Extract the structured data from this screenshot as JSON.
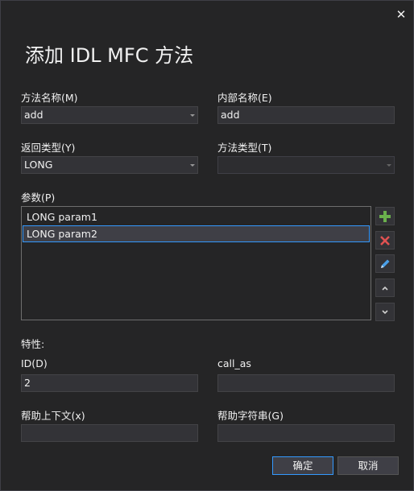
{
  "dialog": {
    "title": "添加 IDL MFC 方法",
    "close_icon": "close-icon"
  },
  "method_name": {
    "label": "方法名称(M)",
    "value": "add"
  },
  "internal_name": {
    "label": "内部名称(E)",
    "value": "add"
  },
  "return_type": {
    "label": "返回类型(Y)",
    "value": "LONG"
  },
  "method_type": {
    "label": "方法类型(T)",
    "value": ""
  },
  "params": {
    "label": "参数(P)",
    "items": [
      "LONG param1",
      "LONG param2"
    ],
    "selected_index": 1,
    "buttons": [
      "add-icon",
      "delete-icon",
      "edit-icon",
      "chevron-up-icon",
      "chevron-down-icon"
    ],
    "colors": {
      "add": "#6ab04c",
      "delete": "#e05252",
      "edit": "#4a9fe8"
    }
  },
  "attributes": {
    "label": "特性:",
    "id": {
      "label": "ID(D)",
      "value": "2"
    },
    "call_as": {
      "label": "call_as",
      "value": ""
    },
    "help_context": {
      "label": "帮助上下文(x)",
      "value": ""
    },
    "help_string": {
      "label": "帮助字符串(G)",
      "value": ""
    }
  },
  "footer": {
    "ok_label": "确定",
    "cancel_label": "取消"
  },
  "colors": {
    "background": "#252526",
    "accent": "#3399ff",
    "field_bg": "#333337"
  }
}
